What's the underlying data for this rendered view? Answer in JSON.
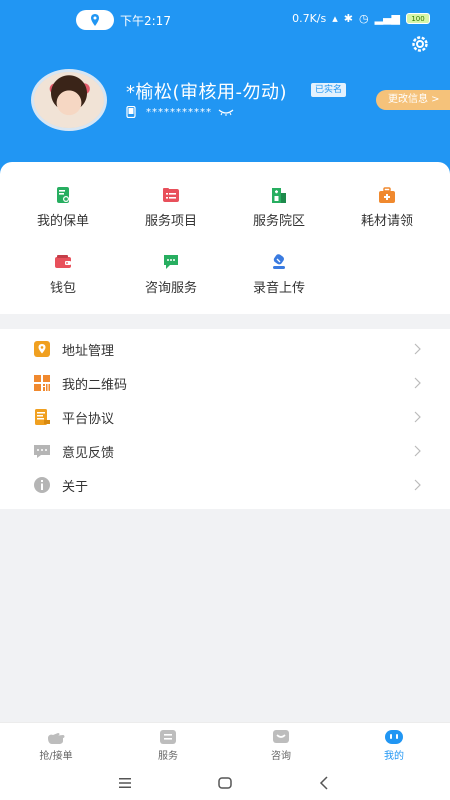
{
  "status": {
    "time": "下午2:17",
    "net_speed": "0.7K/s",
    "battery": "100"
  },
  "profile": {
    "name": "*榆松(审核用-勿动)",
    "verified_badge": "已实名",
    "phone_masked": "***********",
    "edit_button": "更改信息 >"
  },
  "grid": [
    {
      "label": "我的保单",
      "icon": "policy-icon",
      "color": "#27ae60"
    },
    {
      "label": "服务项目",
      "icon": "service-list-icon",
      "color": "#e8505b"
    },
    {
      "label": "服务院区",
      "icon": "hospital-icon",
      "color": "#27ae60"
    },
    {
      "label": "耗材请领",
      "icon": "medkit-icon",
      "color": "#f0892e"
    },
    {
      "label": "钱包",
      "icon": "wallet-icon",
      "color": "#e8505b"
    },
    {
      "label": "咨询服务",
      "icon": "chat-icon",
      "color": "#27ae60"
    },
    {
      "label": "录音上传",
      "icon": "upload-icon",
      "color": "#3a7be0"
    }
  ],
  "menu": [
    {
      "label": "地址管理",
      "icon": "address-icon",
      "color": "#f0a020"
    },
    {
      "label": "我的二维码",
      "icon": "qrcode-icon",
      "color": "#f0892e"
    },
    {
      "label": "平台协议",
      "icon": "agreement-icon",
      "color": "#f0a020"
    },
    {
      "label": "意见反馈",
      "icon": "feedback-icon",
      "color": "#b0b0b0"
    },
    {
      "label": "关于",
      "icon": "info-icon",
      "color": "#b0b0b0"
    }
  ],
  "tabs": [
    {
      "label": "抢/接单"
    },
    {
      "label": "服务"
    },
    {
      "label": "咨询"
    },
    {
      "label": "我的"
    }
  ],
  "colors": {
    "primary": "#2196f3",
    "edit_button": "#f5c27a"
  }
}
